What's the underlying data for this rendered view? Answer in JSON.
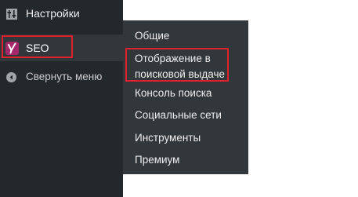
{
  "admin_menu": {
    "settings_label": "Настройки",
    "seo_label": "SEO",
    "collapse_label": "Свернуть меню"
  },
  "seo_submenu": {
    "items": [
      "Общие",
      "Отображение в поисковой выдаче",
      "Консоль поиска",
      "Социальные сети",
      "Инструменты",
      "Премиум"
    ]
  },
  "colors": {
    "menu_background": "#23282d",
    "submenu_background": "#32373c",
    "highlight_border": "#e0202c",
    "yoast_icon": "#a4286a"
  },
  "icons": {
    "settings": "settings-sliders-icon",
    "seo": "yoast-seo-icon",
    "collapse": "collapse-arrow-icon"
  }
}
